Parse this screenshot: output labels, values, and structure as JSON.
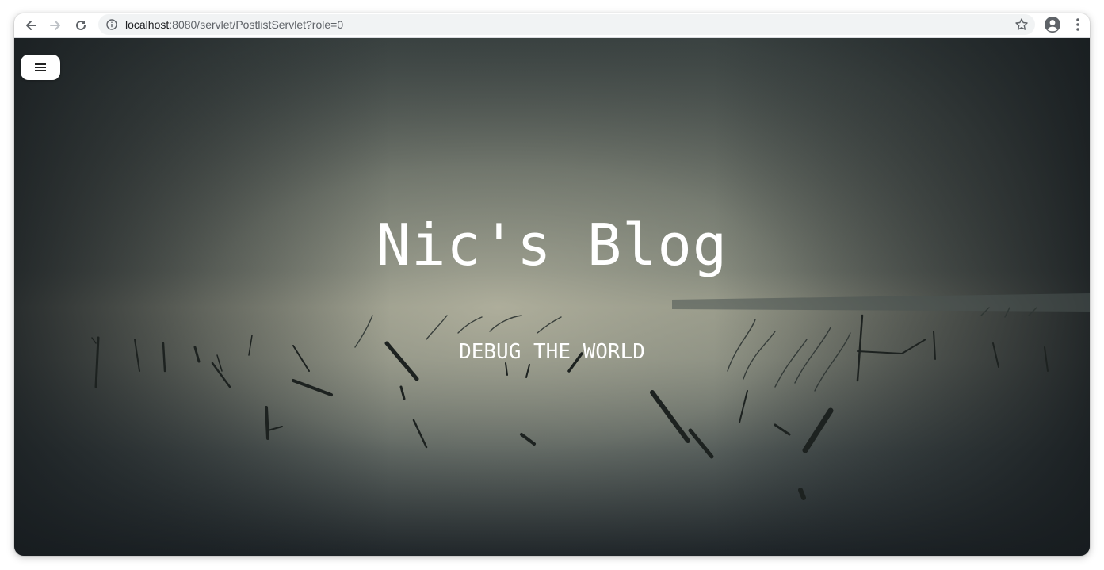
{
  "browser": {
    "url_host": "localhost",
    "url_path": ":8080/servlet/PostlistServlet?role=0",
    "icons": [
      "back-arrow-icon",
      "forward-arrow-icon",
      "reload-icon",
      "info-icon",
      "star-icon",
      "profile-icon",
      "menu-dots-icon"
    ]
  },
  "page": {
    "title": "Nic's Blog",
    "subtitle": "DEBUG THE WORLD",
    "menu_icon": "hamburger-icon"
  },
  "colors": {
    "sky_light": "#8a9086",
    "sky_dark": "#1c2226",
    "water_mist": "#a7a897",
    "text": "#ffffff"
  }
}
